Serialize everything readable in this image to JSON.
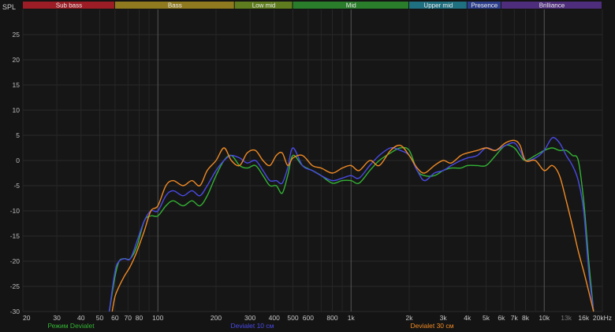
{
  "chart_data": {
    "type": "line",
    "ylabel": "SPL",
    "x_scale": "log",
    "xlim": [
      20,
      20000
    ],
    "ylim": [
      -30,
      30
    ],
    "y_ticks": [
      -30,
      -25,
      -20,
      -15,
      -10,
      -5,
      0,
      5,
      10,
      15,
      20,
      25
    ],
    "x_ticks": [
      {
        "value": 20,
        "label": "20",
        "major": false
      },
      {
        "value": 30,
        "label": "30",
        "major": false
      },
      {
        "value": 40,
        "label": "40",
        "major": false
      },
      {
        "value": 50,
        "label": "50",
        "major": false
      },
      {
        "value": 60,
        "label": "60",
        "major": false
      },
      {
        "value": 70,
        "label": "70",
        "major": false
      },
      {
        "value": 80,
        "label": "80",
        "major": false
      },
      {
        "value": 100,
        "label": "100",
        "major": true
      },
      {
        "value": 200,
        "label": "200",
        "major": false
      },
      {
        "value": 300,
        "label": "300",
        "major": false
      },
      {
        "value": 400,
        "label": "400",
        "major": false
      },
      {
        "value": 500,
        "label": "500",
        "major": false
      },
      {
        "value": 600,
        "label": "600",
        "major": false
      },
      {
        "value": 800,
        "label": "800",
        "major": false
      },
      {
        "value": 1000,
        "label": "1k",
        "major": true
      },
      {
        "value": 2000,
        "label": "2k",
        "major": false
      },
      {
        "value": 3000,
        "label": "3k",
        "major": false
      },
      {
        "value": 4000,
        "label": "4k",
        "major": false
      },
      {
        "value": 5000,
        "label": "5k",
        "major": false
      },
      {
        "value": 6000,
        "label": "6k",
        "major": false
      },
      {
        "value": 7000,
        "label": "7k",
        "major": false
      },
      {
        "value": 8000,
        "label": "8k",
        "major": false
      },
      {
        "value": 10000,
        "label": "10k",
        "major": true
      },
      {
        "value": 13000,
        "label": "13k",
        "major": false,
        "dim": true
      },
      {
        "value": 16000,
        "label": "16k",
        "major": false
      },
      {
        "value": 20000,
        "label": "20kHz",
        "major": false
      }
    ],
    "bands": [
      {
        "name": "Sub bass",
        "from": 20,
        "to": 60,
        "color": "#9c1d25"
      },
      {
        "name": "Bass",
        "from": 60,
        "to": 250,
        "color": "#8f7a1f"
      },
      {
        "name": "Low mid",
        "from": 250,
        "to": 500,
        "color": "#5f7d1e"
      },
      {
        "name": "Mid",
        "from": 500,
        "to": 2000,
        "color": "#2a7d2a"
      },
      {
        "name": "Upper mid",
        "from": 2000,
        "to": 4000,
        "color": "#1f7080"
      },
      {
        "name": "Presence",
        "from": 4000,
        "to": 6000,
        "color": "#2d3f8c"
      },
      {
        "name": "Brilliance",
        "from": 6000,
        "to": 20000,
        "color": "#4e2d7c"
      }
    ],
    "series": [
      {
        "name": "Режим Devialet",
        "color": "#33b233",
        "x": [
          56,
          60,
          63,
          67,
          72,
          78,
          85,
          92,
          100,
          110,
          120,
          135,
          150,
          165,
          180,
          200,
          220,
          240,
          265,
          290,
          320,
          350,
          380,
          410,
          440,
          470,
          500,
          560,
          630,
          700,
          800,
          900,
          1000,
          1100,
          1250,
          1400,
          1600,
          1800,
          2000,
          2200,
          2400,
          2700,
          3000,
          3300,
          3700,
          4000,
          4500,
          5000,
          5600,
          6300,
          7000,
          7500,
          8000,
          9000,
          10000,
          11000,
          12000,
          13000,
          14000,
          15000,
          16000,
          17000,
          18000
        ],
        "y": [
          -30,
          -23,
          -20,
          -19.5,
          -19.5,
          -17,
          -12,
          -11,
          -11,
          -9,
          -8,
          -9,
          -8,
          -9,
          -7,
          -3,
          0,
          1,
          -1,
          -1.5,
          -1,
          -3,
          -5,
          -5,
          -6.5,
          -3,
          1,
          -1,
          -2,
          -3,
          -4.5,
          -4,
          -4,
          -4.5,
          -2,
          0,
          1.5,
          2.5,
          2,
          -2,
          -3,
          -3,
          -2,
          -1.5,
          -1.5,
          -1,
          -1,
          -1,
          1,
          3,
          2.5,
          1,
          0,
          1,
          2,
          2.5,
          2,
          2,
          1,
          0,
          -8,
          -20,
          -30
        ]
      },
      {
        "name": "Devialet 10 см",
        "color": "#4a4ae8",
        "x": [
          56,
          60,
          63,
          67,
          72,
          78,
          85,
          92,
          100,
          110,
          120,
          135,
          150,
          165,
          180,
          200,
          220,
          240,
          265,
          290,
          320,
          350,
          380,
          410,
          440,
          470,
          500,
          560,
          630,
          700,
          800,
          900,
          1000,
          1100,
          1250,
          1400,
          1600,
          1800,
          2000,
          2200,
          2400,
          2700,
          3000,
          3300,
          3700,
          4000,
          4500,
          5000,
          5600,
          6300,
          7000,
          7500,
          8000,
          9000,
          10000,
          11000,
          12000,
          13000,
          14000,
          15000,
          16000,
          17000,
          18000
        ],
        "y": [
          -30,
          -22,
          -20,
          -19.5,
          -19.5,
          -16,
          -12,
          -10,
          -10,
          -7,
          -6,
          -7,
          -6,
          -7,
          -5,
          -2,
          0,
          1,
          0.5,
          -0.5,
          0,
          -2,
          -4,
          -4,
          -4.5,
          -1.5,
          2.5,
          -1,
          -2,
          -3,
          -4,
          -3.5,
          -3,
          -3.5,
          -1,
          1,
          2.5,
          2,
          1,
          -2,
          -4,
          -2.5,
          -2,
          -1,
          0,
          0.5,
          1,
          2.5,
          2,
          3,
          3.5,
          2,
          0,
          0.5,
          2,
          4.5,
          3.5,
          1,
          -1,
          -4,
          -10,
          -22,
          -30
        ]
      },
      {
        "name": "Devialet 30 см",
        "color": "#f08a24",
        "x": [
          58,
          60,
          63,
          67,
          72,
          78,
          85,
          92,
          100,
          110,
          120,
          135,
          150,
          165,
          180,
          200,
          220,
          240,
          265,
          290,
          320,
          350,
          380,
          410,
          440,
          470,
          500,
          560,
          630,
          700,
          800,
          900,
          1000,
          1100,
          1250,
          1400,
          1600,
          1800,
          2000,
          2200,
          2400,
          2700,
          3000,
          3300,
          3700,
          4000,
          4500,
          5000,
          5600,
          6300,
          7000,
          7500,
          8000,
          9000,
          10000,
          11000,
          12000,
          13000,
          14000,
          15000,
          16000,
          17000,
          18000
        ],
        "y": [
          -30,
          -27,
          -25,
          -23,
          -21,
          -18,
          -14,
          -10,
          -9,
          -5,
          -4,
          -5,
          -4,
          -5,
          -2,
          0,
          2.5,
          0,
          -1,
          1.5,
          2,
          0,
          -1,
          1,
          1.5,
          -1,
          0.5,
          1,
          -1,
          -1.5,
          -2.5,
          -1.5,
          -1,
          -2,
          0,
          -1,
          2,
          3,
          1,
          -1.5,
          -2.5,
          -1,
          0,
          -0.5,
          1,
          1.5,
          2,
          2.5,
          2,
          3.5,
          4,
          3,
          0,
          0,
          -2,
          -1,
          -3,
          -8,
          -13,
          -18,
          -22,
          -26,
          -30
        ]
      }
    ]
  }
}
